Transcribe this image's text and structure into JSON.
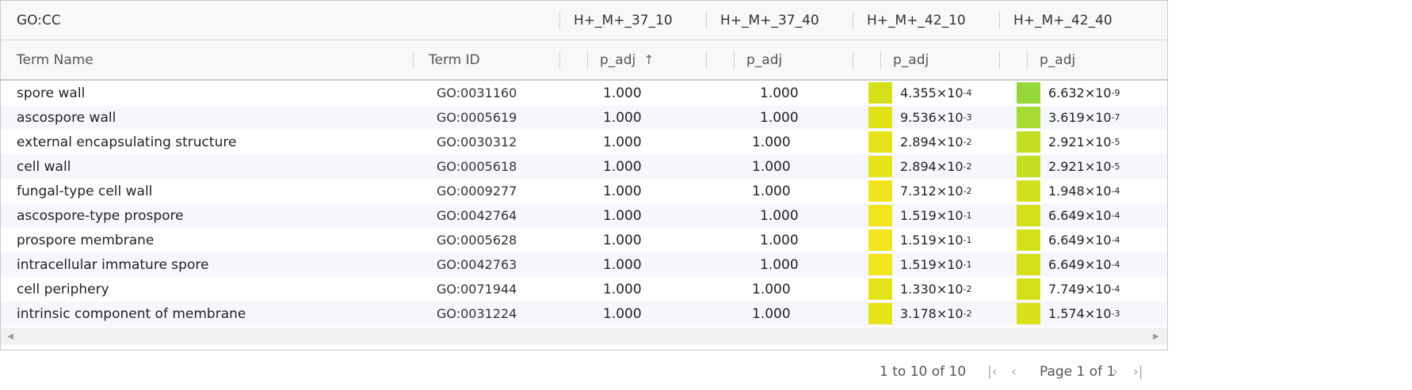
{
  "grid": {
    "group_header": {
      "category": "GO:CC",
      "samples": [
        "H+_M+_37_10",
        "H+_M+_37_40",
        "H+_M+_42_10",
        "H+_M+_42_40"
      ]
    },
    "columns": {
      "term_name": "Term Name",
      "term_id": "Term ID",
      "p_adj": [
        "p_adj",
        "p_adj",
        "p_adj",
        "p_adj"
      ],
      "sort_icon": "arrow-up-icon"
    },
    "rows": [
      {
        "name": "spore wall",
        "id": "GO:0031160",
        "v1": "1.000",
        "v2": "1.000",
        "c3_m": "4.355",
        "c3_e": "-4",
        "c3_color": "#d6e01a",
        "c4_m": "6.632",
        "c4_e": "-9",
        "c4_color": "#96d83a"
      },
      {
        "name": "ascospore wall",
        "id": "GO:0005619",
        "v1": "1.000",
        "v2": "1.000",
        "c3_m": "9.536",
        "c3_e": "-3",
        "c3_color": "#dfe217",
        "c4_m": "3.619",
        "c4_e": "-7",
        "c4_color": "#a6da34"
      },
      {
        "name": "external encapsulating structure",
        "id": "GO:0030312",
        "v1": "1.000",
        "v2": "1.000",
        "c3_m": "2.894",
        "c3_e": "-2",
        "c3_color": "#e6e31a",
        "c4_m": "2.921",
        "c4_e": "-5",
        "c4_color": "#c3de22"
      },
      {
        "name": "cell wall",
        "id": "GO:0005618",
        "v1": "1.000",
        "v2": "1.000",
        "c3_m": "2.894",
        "c3_e": "-2",
        "c3_color": "#e6e31a",
        "c4_m": "2.921",
        "c4_e": "-5",
        "c4_color": "#c3de22"
      },
      {
        "name": "fungal-type cell wall",
        "id": "GO:0009277",
        "v1": "1.000",
        "v2": "1.000",
        "c3_m": "7.312",
        "c3_e": "-2",
        "c3_color": "#ede41c",
        "c4_m": "1.948",
        "c4_e": "-4",
        "c4_color": "#d1e01c"
      },
      {
        "name": "ascospore-type prospore",
        "id": "GO:0042764",
        "v1": "1.000",
        "v2": "1.000",
        "c3_m": "1.519",
        "c3_e": "-1",
        "c3_color": "#f2e51d",
        "c4_m": "6.649",
        "c4_e": "-4",
        "c4_color": "#d6e01a"
      },
      {
        "name": "prospore membrane",
        "id": "GO:0005628",
        "v1": "1.000",
        "v2": "1.000",
        "c3_m": "1.519",
        "c3_e": "-1",
        "c3_color": "#f2e51d",
        "c4_m": "6.649",
        "c4_e": "-4",
        "c4_color": "#d6e01a"
      },
      {
        "name": "intracellular immature spore",
        "id": "GO:0042763",
        "v1": "1.000",
        "v2": "1.000",
        "c3_m": "1.519",
        "c3_e": "-1",
        "c3_color": "#f2e51d",
        "c4_m": "6.649",
        "c4_e": "-4",
        "c4_color": "#d6e01a"
      },
      {
        "name": "cell periphery",
        "id": "GO:0071944",
        "v1": "1.000",
        "v2": "1.000",
        "c3_m": "1.330",
        "c3_e": "-2",
        "c3_color": "#e3e218",
        "c4_m": "7.749",
        "c4_e": "-4",
        "c4_color": "#d6e01a"
      },
      {
        "name": "intrinsic component of membrane",
        "id": "GO:0031224",
        "v1": "1.000",
        "v2": "1.000",
        "c3_m": "3.178",
        "c3_e": "-2",
        "c3_color": "#e6e31a",
        "c4_m": "1.574",
        "c4_e": "-3",
        "c4_color": "#dae11a"
      }
    ],
    "scroll": {
      "left_icon": "scroll-left-icon",
      "right_icon": "scroll-right-icon"
    }
  },
  "pagination": {
    "summary": "1 to 10 of 10",
    "page_label": "Page 1 of 1",
    "icons": [
      "first-page-icon",
      "prev-page-icon",
      "next-page-icon",
      "last-page-icon"
    ]
  }
}
